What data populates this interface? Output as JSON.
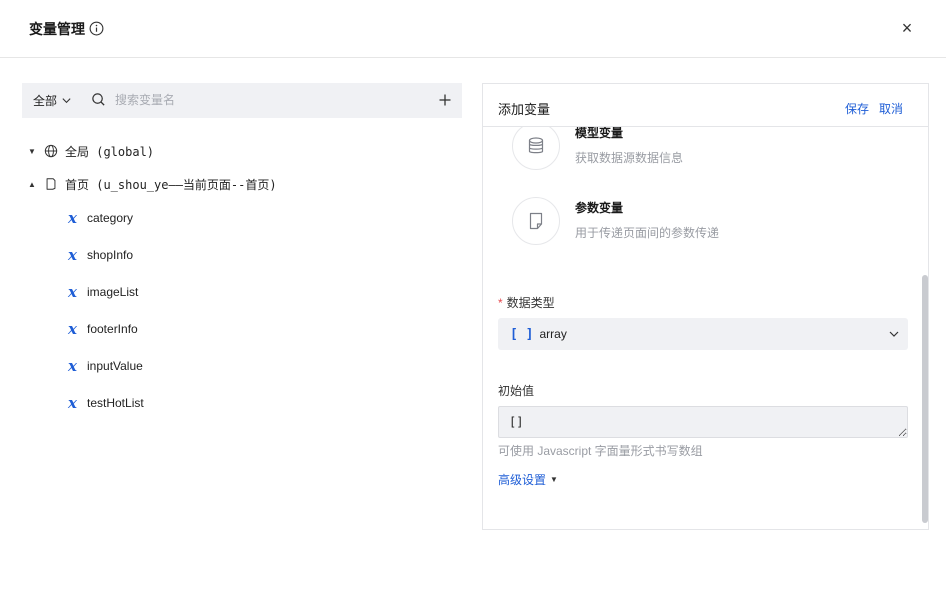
{
  "dialog": {
    "title": "变量管理",
    "close_label": "×"
  },
  "left": {
    "scope_label": "全部",
    "search_placeholder": "搜索变量名",
    "tree": {
      "global": {
        "arrow": "▼",
        "label": "全局 (global)"
      },
      "page": {
        "arrow": "▲",
        "label": "首页 (u_shou_ye——当前页面--首页)"
      },
      "variables": [
        {
          "icon": "x",
          "name": "category"
        },
        {
          "icon": "x",
          "name": "shopInfo"
        },
        {
          "icon": "x",
          "name": "imageList"
        },
        {
          "icon": "x",
          "name": "footerInfo"
        },
        {
          "icon": "x",
          "name": "inputValue"
        },
        {
          "icon": "x",
          "name": "testHotList"
        }
      ]
    }
  },
  "right": {
    "title": "添加变量",
    "save_label": "保存",
    "cancel_label": "取消",
    "options": [
      {
        "icon": "database-icon",
        "title": "模型变量",
        "desc": "获取数据源数据信息"
      },
      {
        "icon": "file-icon",
        "title": "参数变量",
        "desc": "用于传递页面间的参数传递"
      }
    ],
    "data_type": {
      "required_mark": "*",
      "label": "数据类型",
      "icon_text": "[ ]",
      "value": "array"
    },
    "initial_value": {
      "label": "初始值",
      "value": "[]",
      "hint": "可使用 Javascript 字面量形式书写数组"
    },
    "advanced_label": "高级设置",
    "advanced_arrow": "▼"
  },
  "colors": {
    "accent": "#1f5ed6",
    "toolbar_bg": "#f0f1f4",
    "required": "#e5484d"
  }
}
